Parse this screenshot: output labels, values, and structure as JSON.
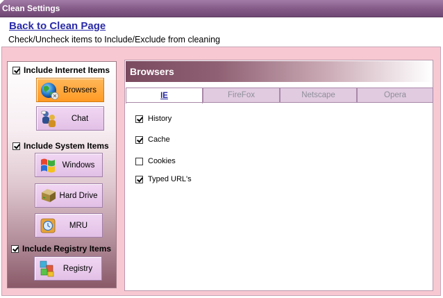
{
  "window": {
    "title": "Clean Settings"
  },
  "back_link": "Back to Clean Page",
  "instructions": "Check/Uncheck items to Include/Exclude from cleaning",
  "sidebar": {
    "internet": {
      "label": "Include Internet Items",
      "checked": true,
      "buttons": [
        {
          "label": "Browsers",
          "icon": "globe-icon",
          "active": true
        },
        {
          "label": "Chat",
          "icon": "chat-people-icon",
          "active": false
        }
      ]
    },
    "system": {
      "label": "Include System Items",
      "checked": true,
      "buttons": [
        {
          "label": "Windows",
          "icon": "windows-flag-icon",
          "active": false
        },
        {
          "label": "Hard Drive",
          "icon": "hard-drive-icon",
          "active": false
        },
        {
          "label": "MRU",
          "icon": "mru-icon",
          "active": false
        }
      ]
    },
    "registry": {
      "label": "Include Registry Items",
      "checked": true,
      "buttons": [
        {
          "label": "Registry",
          "icon": "registry-cubes-icon",
          "active": false
        }
      ]
    }
  },
  "panel": {
    "title": "Browsers",
    "tabs": [
      {
        "label": "IE",
        "active": true
      },
      {
        "label": "FireFox",
        "active": false
      },
      {
        "label": "Netscape",
        "active": false
      },
      {
        "label": "Opera",
        "active": false
      }
    ],
    "options": [
      {
        "label": "History",
        "checked": true
      },
      {
        "label": "Cache",
        "checked": true
      },
      {
        "label": "Cookies",
        "checked": false
      },
      {
        "label": "Typed URL's",
        "checked": true
      }
    ]
  },
  "colors": {
    "titlebar": "#835986",
    "frame": "#f8c8d2",
    "active_button": "#ff9a24",
    "button": "#e2c0e6",
    "link": "#2a2aa8"
  }
}
